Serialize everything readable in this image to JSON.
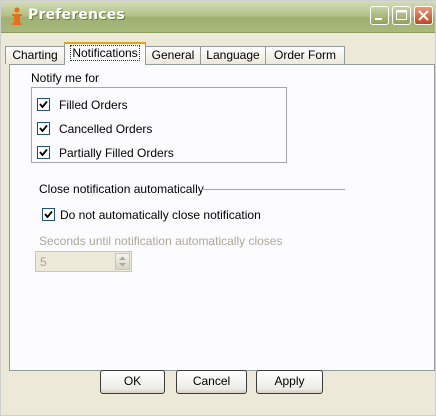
{
  "window": {
    "title": "Preferences",
    "controls": [
      "minimize-icon",
      "maximize-icon",
      "close-icon"
    ]
  },
  "tabs": [
    {
      "label": "Charting",
      "active": false
    },
    {
      "label": "Notifications",
      "active": true
    },
    {
      "label": "General",
      "active": false
    },
    {
      "label": "Language",
      "active": false
    },
    {
      "label": "Order Form",
      "active": false
    }
  ],
  "notify": {
    "header": "Notify me for",
    "items": [
      {
        "label": "Filled Orders",
        "checked": true
      },
      {
        "label": "Cancelled Orders",
        "checked": true
      },
      {
        "label": "Partially Filled Orders",
        "checked": true
      }
    ]
  },
  "auto_close": {
    "header": "Close notification automatically",
    "do_not_close_label": "Do not automatically close notification",
    "do_not_close_checked": true,
    "seconds_label": "Seconds until notification automatically closes",
    "seconds_value": "5",
    "seconds_enabled": false
  },
  "buttons": {
    "ok": "OK",
    "cancel": "Cancel",
    "apply": "Apply"
  },
  "colors": {
    "titlebar": "#a8b97c",
    "close_button": "#c2461f",
    "active_tab_accent": "#e6a500",
    "disabled_text": "#aca899"
  }
}
